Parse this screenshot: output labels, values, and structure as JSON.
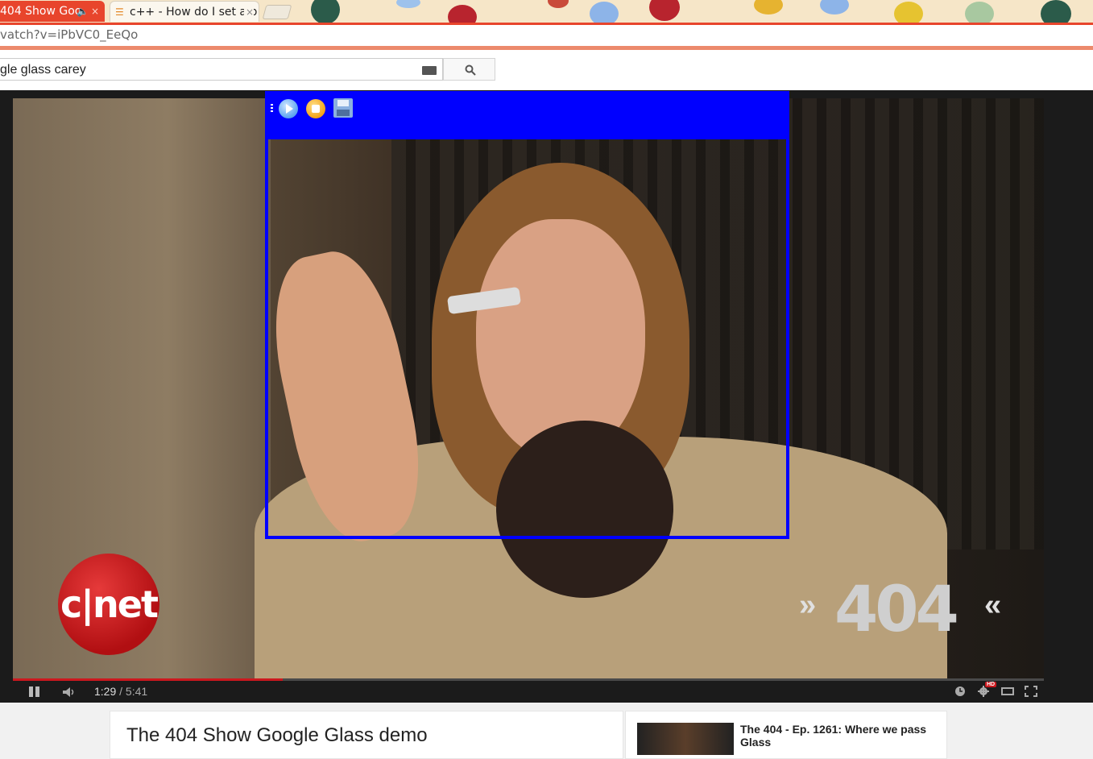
{
  "browser": {
    "tabs": [
      {
        "label": "404 Show Goo",
        "active": true,
        "has_audio_icon": true
      },
      {
        "label": "c++ - How do I set a b",
        "active": false
      }
    ],
    "address": "vatch?v=iPbVC0_EeQo"
  },
  "search": {
    "value": "gle glass carey"
  },
  "overlay": {
    "buttons": [
      "play-icon",
      "stop-icon",
      "save-icon"
    ],
    "color": "#0000ff"
  },
  "player": {
    "current_time": "1:29",
    "separator": " / ",
    "duration": "5:41",
    "progress": 0.262,
    "hd_label": "HD",
    "logo_left": "c|net",
    "logo_right": "404",
    "accent": "#cc181e"
  },
  "watch": {
    "title": "The 404 Show Google Glass demo"
  },
  "related": {
    "first_title": "The 404 - Ep. 1261: Where we pass Glass"
  }
}
